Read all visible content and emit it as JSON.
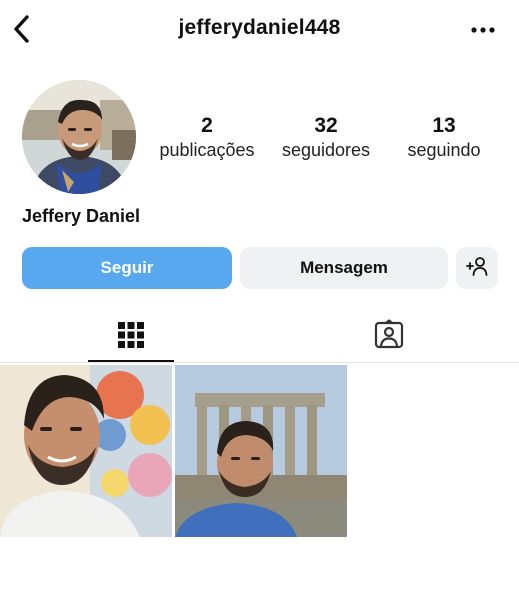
{
  "header": {
    "username": "jefferydaniel448",
    "back_icon": "chevron-left-icon",
    "more_icon": "more-horizontal-icon"
  },
  "profile": {
    "display_name": "Jeffery Daniel",
    "stats": [
      {
        "value": "2",
        "label": "publicações"
      },
      {
        "value": "32",
        "label": "seguidores"
      },
      {
        "value": "13",
        "label": "seguindo"
      }
    ]
  },
  "actions": {
    "follow_label": "Seguir",
    "message_label": "Mensagem",
    "add_user_icon": "add-person-icon"
  },
  "tabs": [
    {
      "name": "posts-grid",
      "icon": "grid-icon",
      "active": true
    },
    {
      "name": "tagged",
      "icon": "tagged-person-icon",
      "active": false
    }
  ],
  "colors": {
    "follow_button": "#58a8ef",
    "secondary_button": "#f0f1f3",
    "text": "#111111"
  }
}
